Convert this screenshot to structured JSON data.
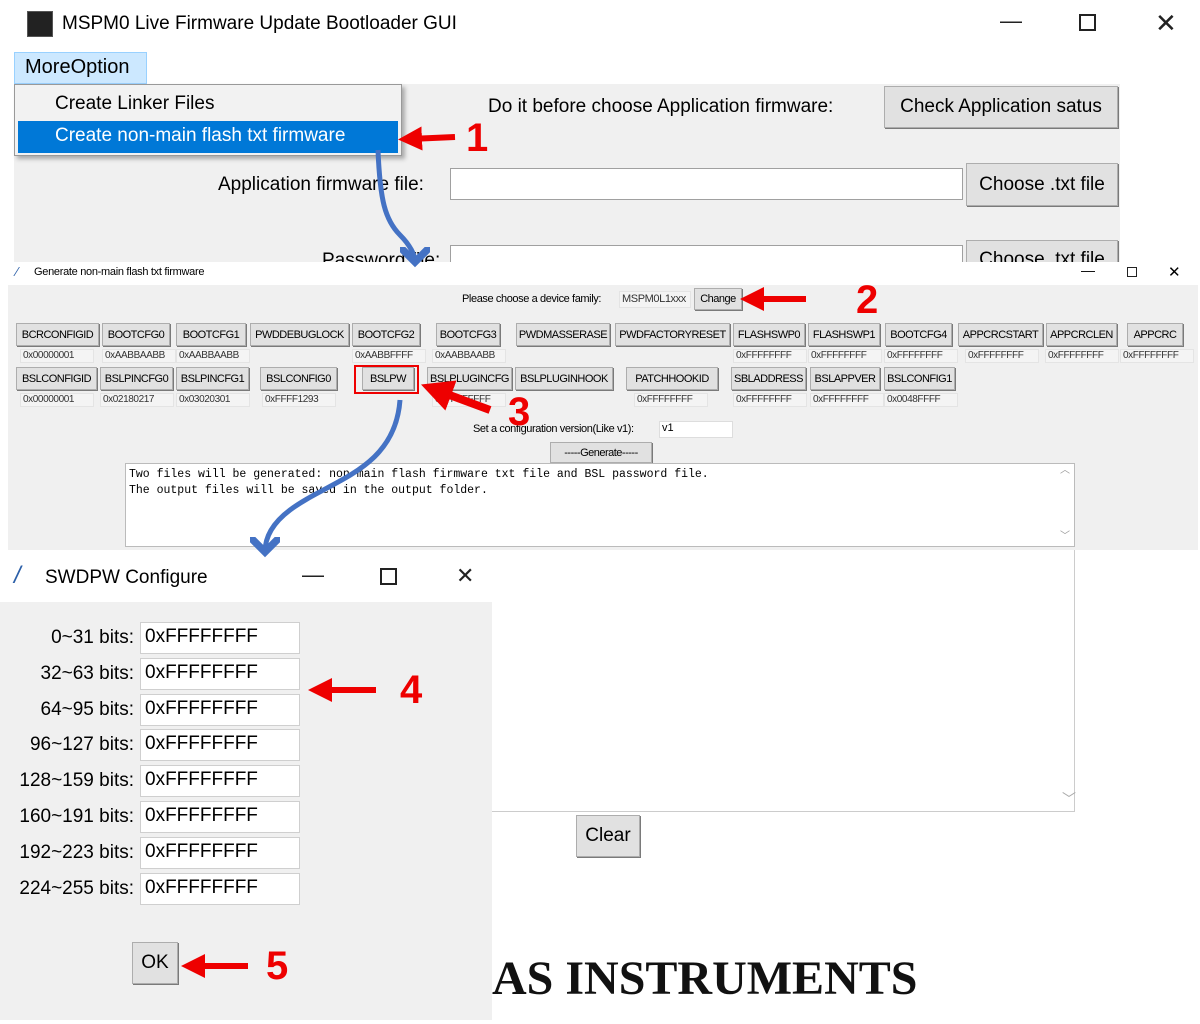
{
  "main": {
    "title": "MSPM0 Live Firmware Update Bootloader GUI",
    "menu": "MoreOption",
    "menu_items": [
      "Create Linker Files",
      "Create non-main flash txt firmware"
    ],
    "do_before_label": "Do it before choose Application firmware:",
    "check_button": "Check Application satus",
    "app_fw_label": "Application firmware file:",
    "app_fw_value": "",
    "choose_button": "Choose .txt file",
    "password_label": "Password file:",
    "choose_button2": "Choose .txt file",
    "clear_button": "Clear",
    "logo_text": "AS INSTRUMENTS"
  },
  "gen": {
    "title": "Generate non-main flash txt firmware",
    "family_label": "Please choose a device family:",
    "family_value": "MSPM0L1xxx",
    "change_button": "Change",
    "row1": [
      {
        "name": "BCRCONFIGID",
        "value": "0x00000001"
      },
      {
        "name": "BOOTCFG0",
        "value": "0xAABBAABB"
      },
      {
        "name": "BOOTCFG1",
        "value": "0xAABBAABB"
      },
      {
        "name": "PWDDEBUGLOCK",
        "value": ""
      },
      {
        "name": "BOOTCFG2",
        "value": "0xAABBFFFF"
      },
      {
        "name": "BOOTCFG3",
        "value": "0xAABBAABB"
      },
      {
        "name": "PWDMASSERASE",
        "value": ""
      },
      {
        "name": "PWDFACTORYRESET",
        "value": ""
      },
      {
        "name": "FLASHSWP0",
        "value": "0xFFFFFFFF"
      },
      {
        "name": "FLASHSWP1",
        "value": "0xFFFFFFFF"
      },
      {
        "name": "BOOTCFG4",
        "value": "0xFFFFFFFF"
      },
      {
        "name": "APPCRCSTART",
        "value": "0xFFFFFFFF"
      },
      {
        "name": "APPCRCLEN",
        "value": "0xFFFFFFFF"
      },
      {
        "name": "APPCRC",
        "value": "0xFFFFFFFF"
      }
    ],
    "row2": [
      {
        "name": "BSLCONFIGID",
        "value": "0x00000001"
      },
      {
        "name": "BSLPINCFG0",
        "value": "0x02180217"
      },
      {
        "name": "BSLPINCFG1",
        "value": "0x03020301"
      },
      {
        "name": "BSLCONFIG0",
        "value": "0xFFFF1293"
      },
      {
        "name": "BSLPW",
        "value": ""
      },
      {
        "name": "BSLPLUGINCFG",
        "value": "0xFFFFFFFF"
      },
      {
        "name": "BSLPLUGINHOOK",
        "value": ""
      },
      {
        "name": "PATCHHOOKID",
        "value": "0xFFFFFFFF"
      },
      {
        "name": "SBLADDRESS",
        "value": "0xFFFFFFFF"
      },
      {
        "name": "BSLAPPVER",
        "value": "0xFFFFFFFF"
      },
      {
        "name": "BSLCONFIG1",
        "value": "0x0048FFFF"
      }
    ],
    "version_label": "Set a configuration version(Like v1):",
    "version_value": "v1",
    "generate_button": "-----Generate-----",
    "output_lines": [
      "Two files will be generated: non-main flash firmware txt file and BSL password file.",
      "The output files will be saved in the output folder."
    ]
  },
  "swdpw": {
    "title": "SWDPW Configure",
    "rows": [
      {
        "label": "0~31 bits:",
        "value": "0xFFFFFFFF"
      },
      {
        "label": "32~63 bits:",
        "value": "0xFFFFFFFF"
      },
      {
        "label": "64~95 bits:",
        "value": "0xFFFFFFFF"
      },
      {
        "label": "96~127 bits:",
        "value": "0xFFFFFFFF"
      },
      {
        "label": "128~159 bits:",
        "value": "0xFFFFFFFF"
      },
      {
        "label": "160~191 bits:",
        "value": "0xFFFFFFFF"
      },
      {
        "label": "192~223 bits:",
        "value": "0xFFFFFFFF"
      },
      {
        "label": "224~255 bits:",
        "value": "0xFFFFFFFF"
      }
    ],
    "ok_button": "OK"
  },
  "annotations": [
    "1",
    "2",
    "3",
    "4",
    "5"
  ],
  "colors": {
    "highlight": "#0078d7",
    "menu_hover": "#cce8ff",
    "annotation_red": "#e00000",
    "arrow_blue": "#4472c4"
  }
}
